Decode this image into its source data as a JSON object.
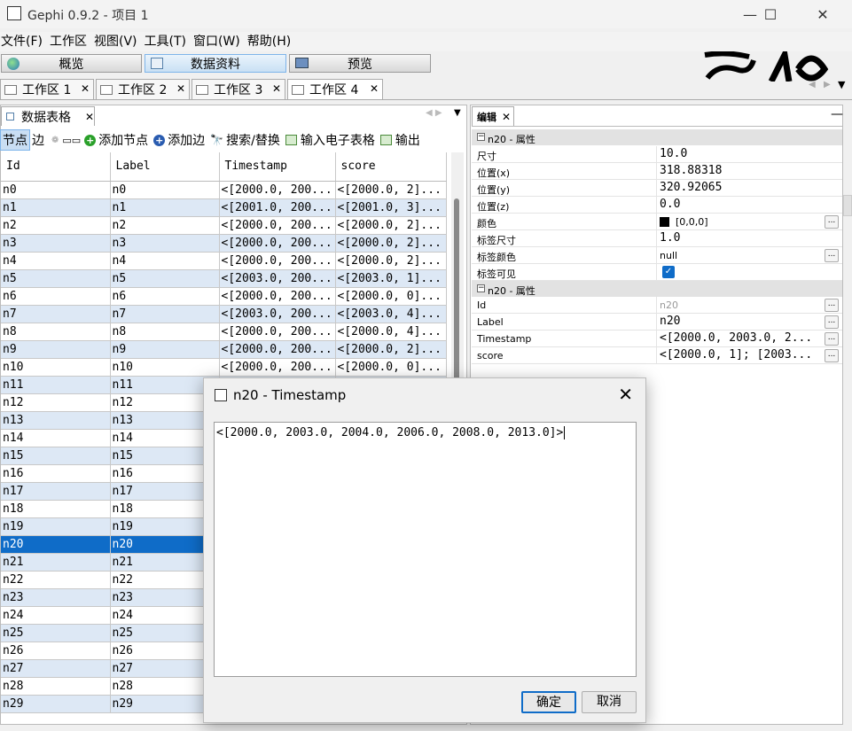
{
  "window": {
    "title": "Gephi 0.9.2 - 项目 1",
    "minimize": "—",
    "maximize": "☐",
    "close": "✕"
  },
  "menu": [
    "文件(F)",
    "工作区",
    "视图(V)",
    "工具(T)",
    "窗口(W)",
    "帮助(H)"
  ],
  "modes": [
    {
      "label": "概览",
      "active": false
    },
    {
      "label": "数据资料",
      "active": true
    },
    {
      "label": "预览",
      "active": false
    }
  ],
  "workspaces": [
    {
      "label": "工作区 1",
      "active": false
    },
    {
      "label": "工作区 2",
      "active": false
    },
    {
      "label": "工作区 3",
      "active": false
    },
    {
      "label": "工作区 4",
      "active": true
    }
  ],
  "data_table_tab": "数据表格",
  "toolbar": {
    "nodes": "节点",
    "edges": "边",
    "add_node": "添加节点",
    "add_edge": "添加边",
    "search_replace": "搜索/替换",
    "import_spreadsheet": "输入电子表格",
    "export": "输出"
  },
  "table": {
    "columns": [
      "Id",
      "Label",
      "Timestamp",
      "score"
    ],
    "rows": [
      [
        "n0",
        "n0",
        "<[2000.0, 200...",
        "<[2000.0, 2]..."
      ],
      [
        "n1",
        "n1",
        "<[2001.0, 200...",
        "<[2001.0, 3]..."
      ],
      [
        "n2",
        "n2",
        "<[2000.0, 200...",
        "<[2000.0, 2]..."
      ],
      [
        "n3",
        "n3",
        "<[2000.0, 200...",
        "<[2000.0, 2]..."
      ],
      [
        "n4",
        "n4",
        "<[2000.0, 200...",
        "<[2000.0, 2]..."
      ],
      [
        "n5",
        "n5",
        "<[2003.0, 200...",
        "<[2003.0, 1]..."
      ],
      [
        "n6",
        "n6",
        "<[2000.0, 200...",
        "<[2000.0, 0]..."
      ],
      [
        "n7",
        "n7",
        "<[2003.0, 200...",
        "<[2003.0, 4]..."
      ],
      [
        "n8",
        "n8",
        "<[2000.0, 200...",
        "<[2000.0, 4]..."
      ],
      [
        "n9",
        "n9",
        "<[2000.0, 200...",
        "<[2000.0, 2]..."
      ],
      [
        "n10",
        "n10",
        "<[2000.0, 200...",
        "<[2000.0, 0]..."
      ],
      [
        "n11",
        "n11",
        "",
        ""
      ],
      [
        "n12",
        "n12",
        "",
        ""
      ],
      [
        "n13",
        "n13",
        "",
        ""
      ],
      [
        "n14",
        "n14",
        "",
        ""
      ],
      [
        "n15",
        "n15",
        "",
        ""
      ],
      [
        "n16",
        "n16",
        "",
        ""
      ],
      [
        "n17",
        "n17",
        "",
        ""
      ],
      [
        "n18",
        "n18",
        "",
        ""
      ],
      [
        "n19",
        "n19",
        "",
        ""
      ],
      [
        "n20",
        "n20",
        "",
        ""
      ],
      [
        "n21",
        "n21",
        "",
        ""
      ],
      [
        "n22",
        "n22",
        "",
        ""
      ],
      [
        "n23",
        "n23",
        "",
        ""
      ],
      [
        "n24",
        "n24",
        "",
        ""
      ],
      [
        "n25",
        "n25",
        "",
        ""
      ],
      [
        "n26",
        "n26",
        "",
        ""
      ],
      [
        "n27",
        "n27",
        "",
        ""
      ],
      [
        "n28",
        "n28",
        "",
        ""
      ],
      [
        "n29",
        "n29",
        "",
        ""
      ]
    ],
    "selected_row": "n20"
  },
  "editor": {
    "tab": "编辑",
    "group1": "n20 - 属性",
    "props1": [
      {
        "k": "尺寸",
        "v": "10.0"
      },
      {
        "k": "位置(x)",
        "v": "318.88318"
      },
      {
        "k": "位置(y)",
        "v": "320.92065"
      },
      {
        "k": "位置(z)",
        "v": "0.0"
      },
      {
        "k": "颜色",
        "v": "[0,0,0]",
        "swatch": "#000000",
        "ellipsis": "..."
      },
      {
        "k": "标签尺寸",
        "v": "1.0"
      },
      {
        "k": "标签颜色",
        "v": "null",
        "ellipsis": "..."
      },
      {
        "k": "标签可见",
        "check": true
      }
    ],
    "group2": "n20 - 属性",
    "props2": [
      {
        "k": "Id",
        "v": "n20",
        "ellipsis": "..."
      },
      {
        "k": "Label",
        "v": "n20",
        "ellipsis": "..."
      },
      {
        "k": "Timestamp",
        "v": "<[2000.0, 2003.0, 2...",
        "ellipsis": "..."
      },
      {
        "k": "score",
        "v": "<[2000.0, 1]; [2003...",
        "ellipsis": "..."
      }
    ]
  },
  "dialog": {
    "title": "n20 - Timestamp",
    "text": "<[2000.0, 2003.0, 2004.0, 2006.0, 2008.0, 2013.0]>",
    "ok": "确定",
    "cancel": "取消"
  },
  "colors": {
    "accent": "#0f6cc8",
    "alt_row": "#dde8f5"
  }
}
